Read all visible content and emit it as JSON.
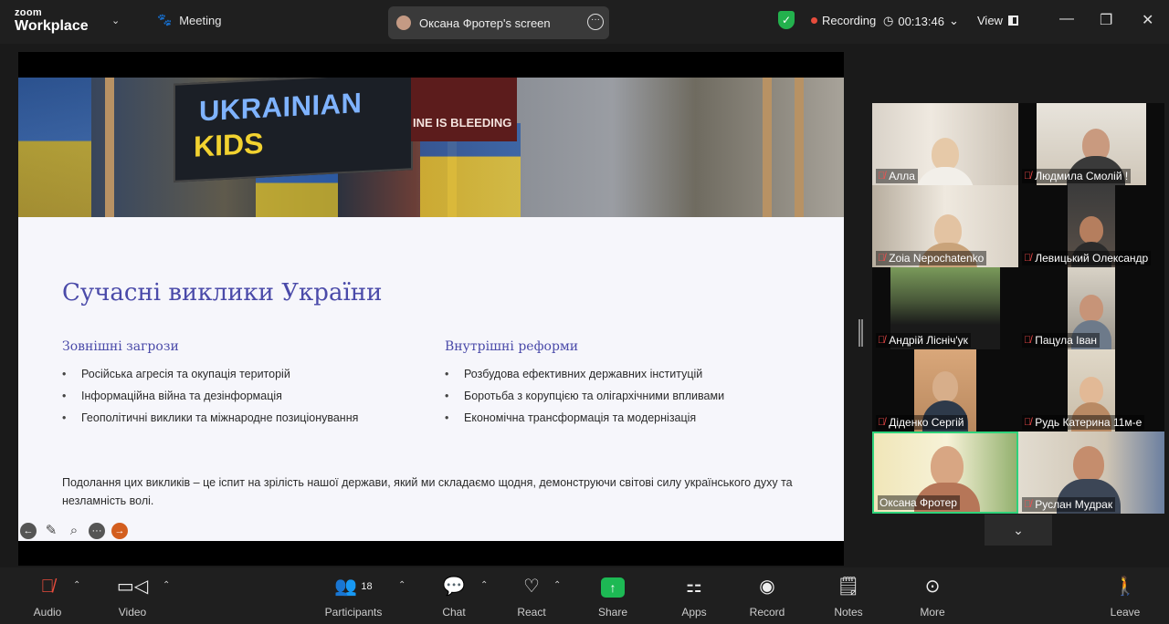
{
  "app": {
    "logo_top": "zoom",
    "logo_bottom": "Workplace",
    "meeting_label": "Meeting"
  },
  "share": {
    "label": "Оксана Фротер's screen",
    "more": "···"
  },
  "status": {
    "recording": "Recording",
    "timer": "00:13:46",
    "view": "View"
  },
  "slide": {
    "photo_text1": "UKRAINIAN",
    "photo_text2": "KIDS",
    "photo_text3": "INE IS BLEEDING",
    "title": "Сучасні виклики України",
    "left_heading": "Зовнішні загрози",
    "left_items": [
      "Російська агресія та окупація територій",
      "Інформаційна війна та дезінформація",
      "Геополітичні виклики та міжнародне позиціонування"
    ],
    "right_heading": "Внутрішні реформи",
    "right_items": [
      "Розбудова ефективних державних інституцій",
      "Боротьба з корупцією та олігархічними впливами",
      "Економічна трансформація та модернізація"
    ],
    "paragraph": "Подолання цих викликів – це іспит на зрілість нашої держави, який ми складаємо щодня, демонструючи світові силу українського духу та незламність волі."
  },
  "participants": [
    {
      "name": "Алла"
    },
    {
      "name": "Людмила Смолій !"
    },
    {
      "name": "Zoia Nepochatenko"
    },
    {
      "name": "Левицький Олександр"
    },
    {
      "name": "Андрій Лісніч'ук"
    },
    {
      "name": "Пацула Іван"
    },
    {
      "name": "Діденко Сергій"
    },
    {
      "name": "Рудь Катерина 11м-е"
    },
    {
      "name": "Оксана Фротер"
    },
    {
      "name": "Руслан Мудрак"
    }
  ],
  "toolbar": {
    "audio": "Audio",
    "video": "Video",
    "participants": "Participants",
    "participants_count": "18",
    "chat": "Chat",
    "react": "React",
    "share": "Share",
    "apps": "Apps",
    "record": "Record",
    "notes": "Notes",
    "more": "More",
    "leave": "Leave"
  },
  "icons": [
    "shield-icon",
    "gear-icon",
    "mic-muted-icon",
    "camera-icon",
    "participants-icon",
    "chat-icon",
    "heart-icon",
    "share-arrow-icon",
    "apps-icon",
    "record-icon",
    "notes-icon",
    "more-icon",
    "leave-icon"
  ]
}
